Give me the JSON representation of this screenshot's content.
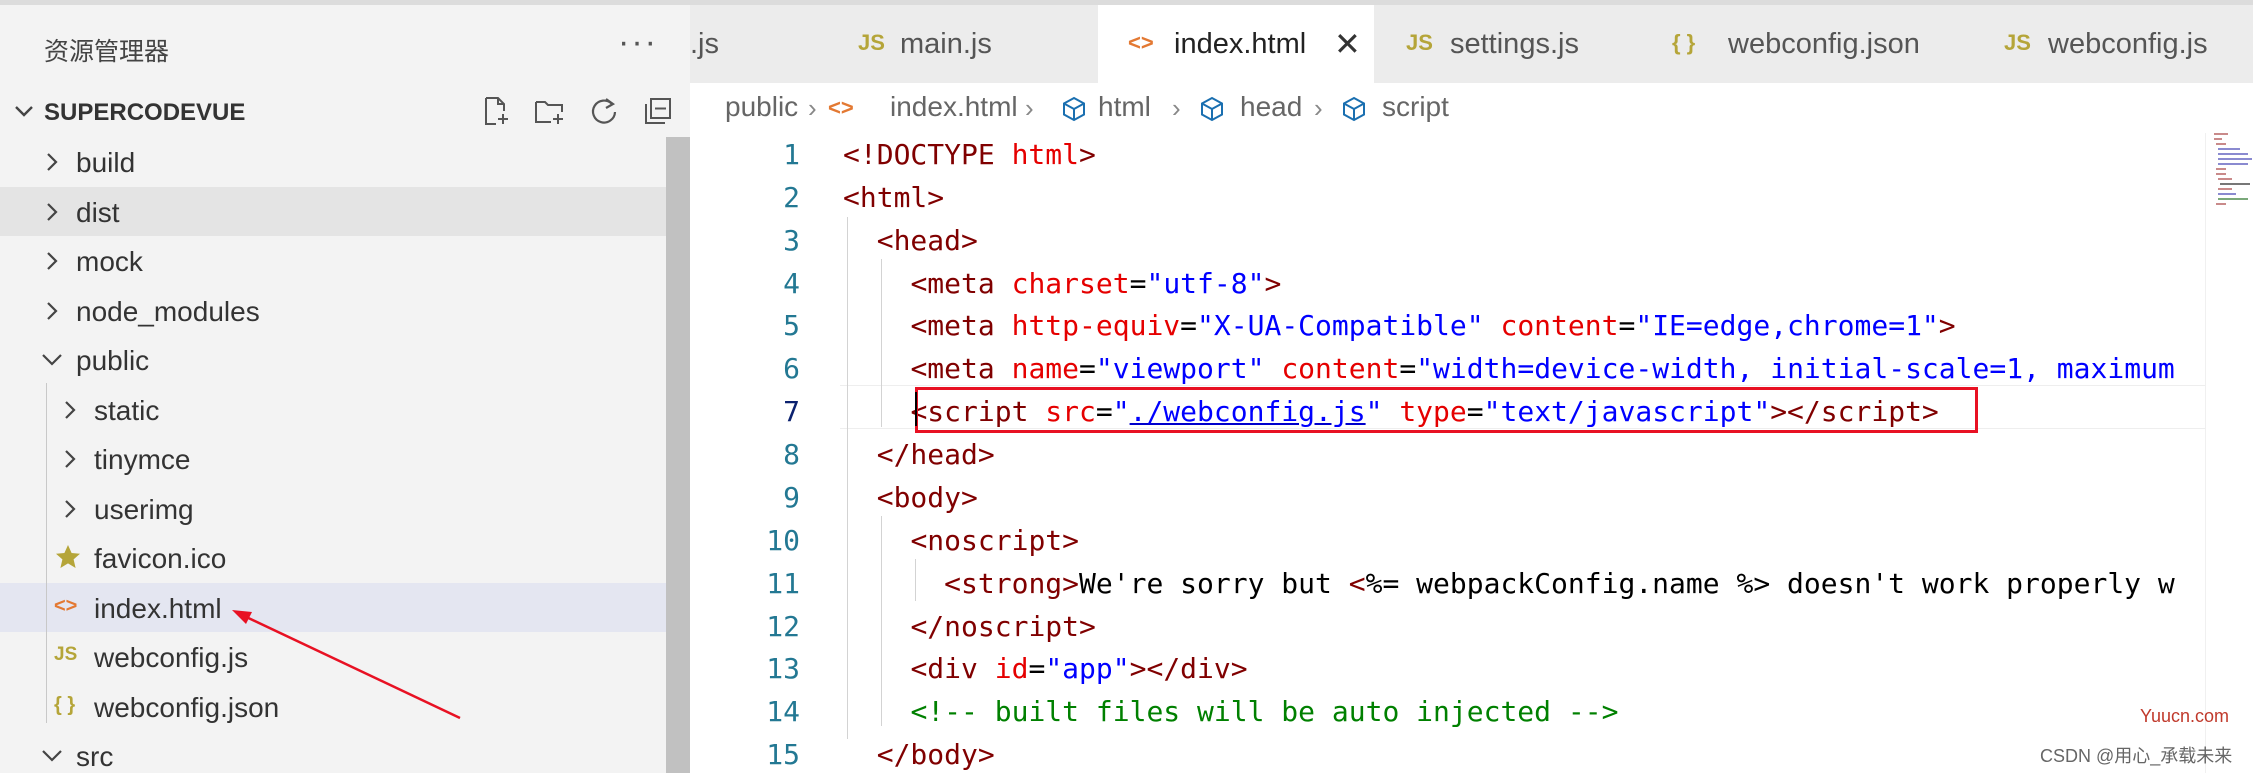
{
  "explorer": {
    "title": "资源管理器",
    "more": "···",
    "project": "SUPERCODEVUE",
    "tools": [
      "new-file-icon",
      "new-folder-icon",
      "refresh-icon",
      "collapse-all-icon"
    ],
    "items": [
      {
        "name": "build",
        "type": "folder"
      },
      {
        "name": "dist",
        "type": "folder"
      },
      {
        "name": "mock",
        "type": "folder"
      },
      {
        "name": "node_modules",
        "type": "folder"
      },
      {
        "name": "public",
        "type": "folder-open"
      },
      {
        "name": "static",
        "type": "folder"
      },
      {
        "name": "tinymce",
        "type": "folder"
      },
      {
        "name": "userimg",
        "type": "folder"
      },
      {
        "name": "favicon.ico",
        "type": "favicon"
      },
      {
        "name": "index.html",
        "type": "html"
      },
      {
        "name": "webconfig.js",
        "type": "js"
      },
      {
        "name": "webconfig.json",
        "type": "json"
      },
      {
        "name": "src",
        "type": "folder-open"
      }
    ]
  },
  "tabs": [
    {
      "label": ".js",
      "icon": ""
    },
    {
      "label": "main.js",
      "icon": "JS"
    },
    {
      "label": "index.html",
      "icon": "<>",
      "close": "✕"
    },
    {
      "label": "settings.js",
      "icon": "JS"
    },
    {
      "label": "webconfig.json",
      "icon": "{ }"
    },
    {
      "label": "webconfig.js",
      "icon": "JS"
    }
  ],
  "breadcrumb": [
    "public",
    "index.html",
    "html",
    "head",
    "script"
  ],
  "editor": {
    "line_numbers": [
      "1",
      "2",
      "3",
      "4",
      "5",
      "6",
      "7",
      "8",
      "9",
      "10",
      "11",
      "12",
      "13",
      "14",
      "15"
    ],
    "current_line": 7
  },
  "watermarks": {
    "site": "Yuucn.com",
    "author": "CSDN @用心_承载未来"
  },
  "colors": {
    "tag": "#800000",
    "attribute": "#e50000",
    "value": "#0000ff",
    "comment": "#008000",
    "highlight_box": "#e81123",
    "js_icon": "#b5a539",
    "html_icon": "#e37933"
  }
}
